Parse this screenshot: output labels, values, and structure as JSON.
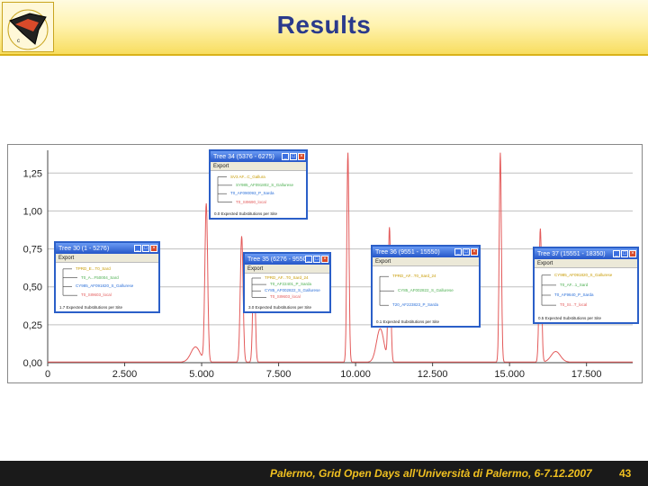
{
  "header": {
    "title": "Results"
  },
  "footer": {
    "text": "Palermo, Grid Open Days all'Università di Palermo, 6-7.12.2007",
    "page": "43"
  },
  "colors": {
    "line": "#e35a5a",
    "title": "#2a3a8c",
    "footer_text": "#f0c020",
    "window_border": "#2b5fc8"
  },
  "chart_data": {
    "type": "line",
    "title": "",
    "xlabel": "",
    "ylabel": "",
    "xlim": [
      0,
      19000
    ],
    "ylim": [
      0,
      1.4
    ],
    "xticks": [
      0,
      2500,
      5000,
      7500,
      10000,
      12500,
      15000,
      17500
    ],
    "xtick_labels": [
      "0",
      "2.500",
      "5.000",
      "7.500",
      "10.000",
      "12.500",
      "15.000",
      "17.500"
    ],
    "yticks": [
      0.0,
      0.25,
      0.5,
      0.75,
      1.0,
      1.25
    ],
    "ytick_labels": [
      "0,00",
      "0,25",
      "0,50",
      "0,75",
      "1,00",
      "1,25"
    ],
    "grid": true,
    "series": [
      {
        "peaks": [
          {
            "x": 4800,
            "h": 0.1,
            "w": 150
          },
          {
            "x": 5150,
            "h": 1.04,
            "w": 45
          },
          {
            "x": 6300,
            "h": 0.83,
            "w": 45
          },
          {
            "x": 6700,
            "h": 0.68,
            "w": 40
          },
          {
            "x": 9750,
            "h": 1.38,
            "w": 35
          },
          {
            "x": 10800,
            "h": 0.22,
            "w": 120
          },
          {
            "x": 11100,
            "h": 0.88,
            "w": 40
          },
          {
            "x": 14700,
            "h": 1.38,
            "w": 35
          },
          {
            "x": 16000,
            "h": 0.88,
            "w": 40
          },
          {
            "x": 16500,
            "h": 0.07,
            "w": 150
          }
        ]
      }
    ]
  },
  "windows": [
    {
      "title": "Tree 34 (5376 - 6275)",
      "export": "Export",
      "leaves": [
        "SV3 AF...C_Gallura",
        "SY985_AF091802_S_Gallurese",
        "T0_AF090093_P_Sarda",
        "T0_SI9690_local"
      ],
      "footer": "0.0 Expected Substitutions per Site"
    },
    {
      "title": "Tree 30 (1 - 5276)",
      "export": "Export",
      "leaves": [
        "TPRD_E...T0_Sard",
        "T0_A...F50004_Sard",
        "CY985_AF091820_S_Gallurese",
        "T0_SI9603_local"
      ],
      "footer": "1.7 Expected Substitutions per Site"
    },
    {
      "title": "Tree 35 (6276 - 9550)",
      "export": "Export",
      "leaves": [
        "TPRD_AF...T0_Sard_24",
        "T0_AF22401_P_Sarda",
        "CY85_AF002822_S_Gallurese",
        "T0_SI9603_local"
      ],
      "footer": "3.0 Expected Substitutions per Site"
    },
    {
      "title": "Tree 36 (9551 - 15550)",
      "export": "Export",
      "leaves": [
        "TPRD_AF...T0_Sard_24",
        "CY85_AF002822_S_Gallurese",
        "T20_AF223823_P_Sarda"
      ],
      "footer": "0.1 Expected Substitutions per Site"
    },
    {
      "title": "Tree 37 (15551 - 18350)",
      "export": "Export",
      "leaves": [
        "CY985_AF091820_S_Gallurese",
        "T0_AF...1_Sard",
        "T0_AF9640_P_Sarda",
        "T0_SI...T_local"
      ],
      "footer": "0.5 Expected Substitutions per Site"
    }
  ]
}
